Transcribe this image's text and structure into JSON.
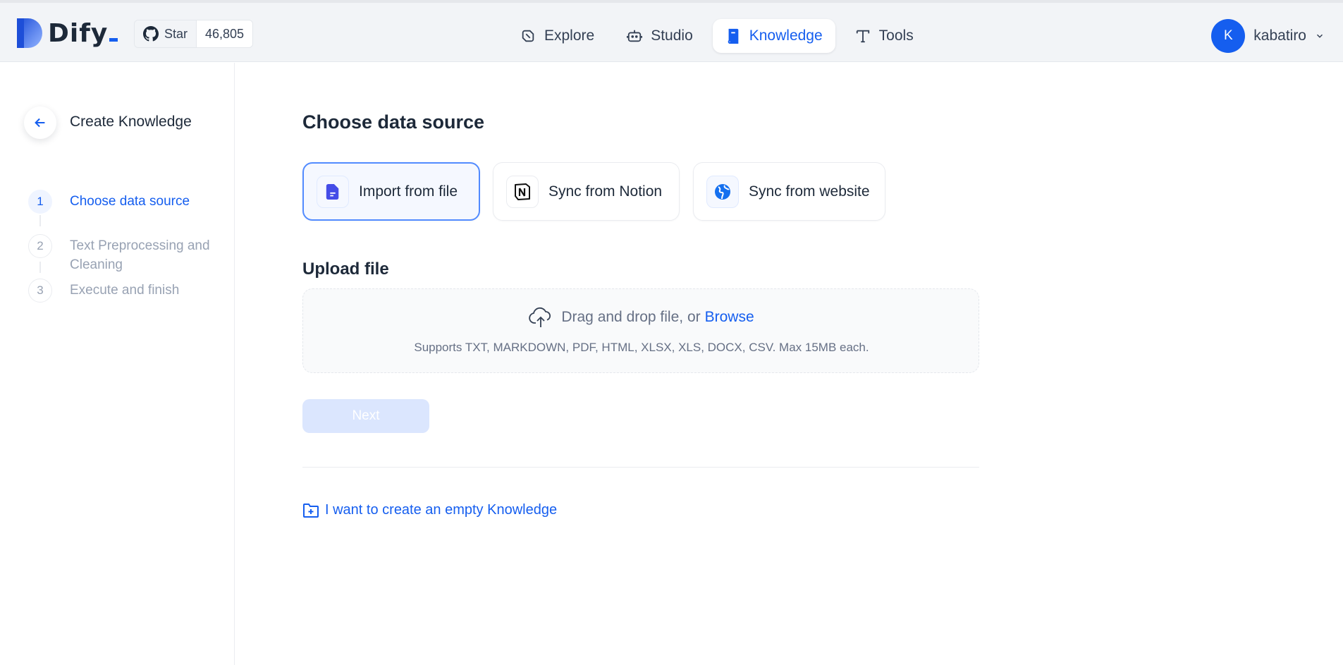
{
  "app": {
    "name": "Dify"
  },
  "github": {
    "star_label": "Star",
    "star_count": "46,805"
  },
  "nav": {
    "explore": "Explore",
    "studio": "Studio",
    "knowledge": "Knowledge",
    "tools": "Tools",
    "active": "Knowledge"
  },
  "user": {
    "initial": "K",
    "name": "kabatiro"
  },
  "sidebar": {
    "title": "Create Knowledge",
    "steps": [
      {
        "num": "1",
        "label": "Choose data source",
        "active": true
      },
      {
        "num": "2",
        "label": "Text Preprocessing and Cleaning",
        "active": false
      },
      {
        "num": "3",
        "label": "Execute and finish",
        "active": false
      }
    ]
  },
  "main": {
    "heading": "Choose data source",
    "sources": [
      {
        "label": "Import from file",
        "icon": "file-icon",
        "selected": true
      },
      {
        "label": "Sync from Notion",
        "icon": "notion-icon",
        "selected": false
      },
      {
        "label": "Sync from website",
        "icon": "globe-icon",
        "selected": false
      }
    ],
    "upload_heading": "Upload file",
    "drop_text": "Drag and drop file, or",
    "browse_label": "Browse",
    "supports_text": "Supports TXT, MARKDOWN, PDF, HTML, XLSX, XLS, DOCX, CSV. Max 15MB each.",
    "next_label": "Next",
    "empty_link": "I want to create an empty Knowledge"
  },
  "colors": {
    "accent": "#155eef",
    "header_bg": "#f2f4f7",
    "next_disabled": "#dbe6fe"
  }
}
